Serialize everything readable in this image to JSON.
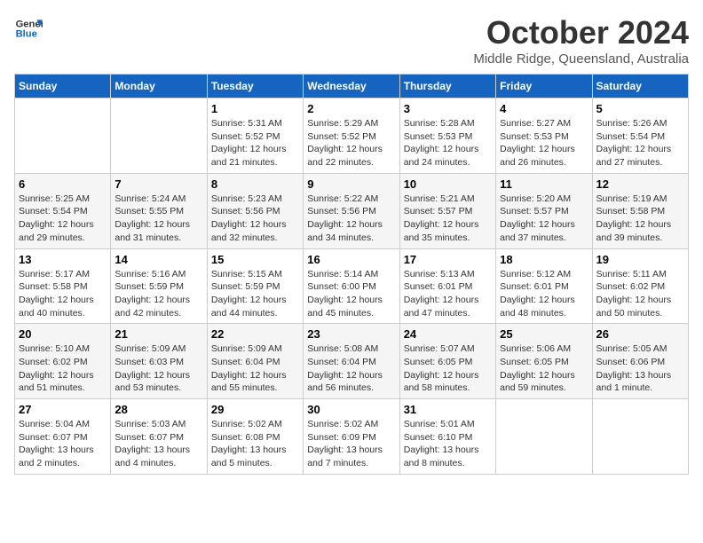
{
  "header": {
    "logo_line1": "General",
    "logo_line2": "Blue",
    "month": "October 2024",
    "location": "Middle Ridge, Queensland, Australia"
  },
  "days_of_week": [
    "Sunday",
    "Monday",
    "Tuesday",
    "Wednesday",
    "Thursday",
    "Friday",
    "Saturday"
  ],
  "weeks": [
    [
      {
        "day": "",
        "sunrise": "",
        "sunset": "",
        "daylight": ""
      },
      {
        "day": "",
        "sunrise": "",
        "sunset": "",
        "daylight": ""
      },
      {
        "day": "1",
        "sunrise": "Sunrise: 5:31 AM",
        "sunset": "Sunset: 5:52 PM",
        "daylight": "Daylight: 12 hours and 21 minutes."
      },
      {
        "day": "2",
        "sunrise": "Sunrise: 5:29 AM",
        "sunset": "Sunset: 5:52 PM",
        "daylight": "Daylight: 12 hours and 22 minutes."
      },
      {
        "day": "3",
        "sunrise": "Sunrise: 5:28 AM",
        "sunset": "Sunset: 5:53 PM",
        "daylight": "Daylight: 12 hours and 24 minutes."
      },
      {
        "day": "4",
        "sunrise": "Sunrise: 5:27 AM",
        "sunset": "Sunset: 5:53 PM",
        "daylight": "Daylight: 12 hours and 26 minutes."
      },
      {
        "day": "5",
        "sunrise": "Sunrise: 5:26 AM",
        "sunset": "Sunset: 5:54 PM",
        "daylight": "Daylight: 12 hours and 27 minutes."
      }
    ],
    [
      {
        "day": "6",
        "sunrise": "Sunrise: 5:25 AM",
        "sunset": "Sunset: 5:54 PM",
        "daylight": "Daylight: 12 hours and 29 minutes."
      },
      {
        "day": "7",
        "sunrise": "Sunrise: 5:24 AM",
        "sunset": "Sunset: 5:55 PM",
        "daylight": "Daylight: 12 hours and 31 minutes."
      },
      {
        "day": "8",
        "sunrise": "Sunrise: 5:23 AM",
        "sunset": "Sunset: 5:56 PM",
        "daylight": "Daylight: 12 hours and 32 minutes."
      },
      {
        "day": "9",
        "sunrise": "Sunrise: 5:22 AM",
        "sunset": "Sunset: 5:56 PM",
        "daylight": "Daylight: 12 hours and 34 minutes."
      },
      {
        "day": "10",
        "sunrise": "Sunrise: 5:21 AM",
        "sunset": "Sunset: 5:57 PM",
        "daylight": "Daylight: 12 hours and 35 minutes."
      },
      {
        "day": "11",
        "sunrise": "Sunrise: 5:20 AM",
        "sunset": "Sunset: 5:57 PM",
        "daylight": "Daylight: 12 hours and 37 minutes."
      },
      {
        "day": "12",
        "sunrise": "Sunrise: 5:19 AM",
        "sunset": "Sunset: 5:58 PM",
        "daylight": "Daylight: 12 hours and 39 minutes."
      }
    ],
    [
      {
        "day": "13",
        "sunrise": "Sunrise: 5:17 AM",
        "sunset": "Sunset: 5:58 PM",
        "daylight": "Daylight: 12 hours and 40 minutes."
      },
      {
        "day": "14",
        "sunrise": "Sunrise: 5:16 AM",
        "sunset": "Sunset: 5:59 PM",
        "daylight": "Daylight: 12 hours and 42 minutes."
      },
      {
        "day": "15",
        "sunrise": "Sunrise: 5:15 AM",
        "sunset": "Sunset: 5:59 PM",
        "daylight": "Daylight: 12 hours and 44 minutes."
      },
      {
        "day": "16",
        "sunrise": "Sunrise: 5:14 AM",
        "sunset": "Sunset: 6:00 PM",
        "daylight": "Daylight: 12 hours and 45 minutes."
      },
      {
        "day": "17",
        "sunrise": "Sunrise: 5:13 AM",
        "sunset": "Sunset: 6:01 PM",
        "daylight": "Daylight: 12 hours and 47 minutes."
      },
      {
        "day": "18",
        "sunrise": "Sunrise: 5:12 AM",
        "sunset": "Sunset: 6:01 PM",
        "daylight": "Daylight: 12 hours and 48 minutes."
      },
      {
        "day": "19",
        "sunrise": "Sunrise: 5:11 AM",
        "sunset": "Sunset: 6:02 PM",
        "daylight": "Daylight: 12 hours and 50 minutes."
      }
    ],
    [
      {
        "day": "20",
        "sunrise": "Sunrise: 5:10 AM",
        "sunset": "Sunset: 6:02 PM",
        "daylight": "Daylight: 12 hours and 51 minutes."
      },
      {
        "day": "21",
        "sunrise": "Sunrise: 5:09 AM",
        "sunset": "Sunset: 6:03 PM",
        "daylight": "Daylight: 12 hours and 53 minutes."
      },
      {
        "day": "22",
        "sunrise": "Sunrise: 5:09 AM",
        "sunset": "Sunset: 6:04 PM",
        "daylight": "Daylight: 12 hours and 55 minutes."
      },
      {
        "day": "23",
        "sunrise": "Sunrise: 5:08 AM",
        "sunset": "Sunset: 6:04 PM",
        "daylight": "Daylight: 12 hours and 56 minutes."
      },
      {
        "day": "24",
        "sunrise": "Sunrise: 5:07 AM",
        "sunset": "Sunset: 6:05 PM",
        "daylight": "Daylight: 12 hours and 58 minutes."
      },
      {
        "day": "25",
        "sunrise": "Sunrise: 5:06 AM",
        "sunset": "Sunset: 6:05 PM",
        "daylight": "Daylight: 12 hours and 59 minutes."
      },
      {
        "day": "26",
        "sunrise": "Sunrise: 5:05 AM",
        "sunset": "Sunset: 6:06 PM",
        "daylight": "Daylight: 13 hours and 1 minute."
      }
    ],
    [
      {
        "day": "27",
        "sunrise": "Sunrise: 5:04 AM",
        "sunset": "Sunset: 6:07 PM",
        "daylight": "Daylight: 13 hours and 2 minutes."
      },
      {
        "day": "28",
        "sunrise": "Sunrise: 5:03 AM",
        "sunset": "Sunset: 6:07 PM",
        "daylight": "Daylight: 13 hours and 4 minutes."
      },
      {
        "day": "29",
        "sunrise": "Sunrise: 5:02 AM",
        "sunset": "Sunset: 6:08 PM",
        "daylight": "Daylight: 13 hours and 5 minutes."
      },
      {
        "day": "30",
        "sunrise": "Sunrise: 5:02 AM",
        "sunset": "Sunset: 6:09 PM",
        "daylight": "Daylight: 13 hours and 7 minutes."
      },
      {
        "day": "31",
        "sunrise": "Sunrise: 5:01 AM",
        "sunset": "Sunset: 6:10 PM",
        "daylight": "Daylight: 13 hours and 8 minutes."
      },
      {
        "day": "",
        "sunrise": "",
        "sunset": "",
        "daylight": ""
      },
      {
        "day": "",
        "sunrise": "",
        "sunset": "",
        "daylight": ""
      }
    ]
  ]
}
